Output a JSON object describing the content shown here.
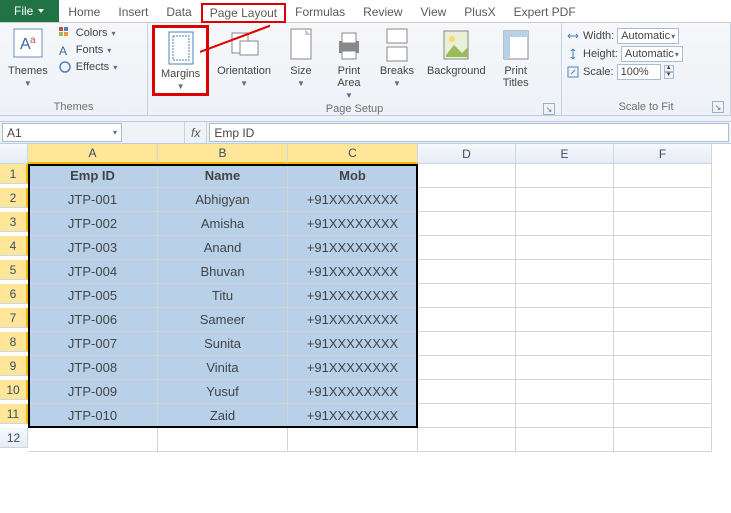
{
  "tabs": {
    "file": "File",
    "home": "Home",
    "insert": "Insert",
    "data": "Data",
    "pagelayout": "Page Layout",
    "formulas": "Formulas",
    "review": "Review",
    "view": "View",
    "plusx": "PlusX",
    "expertpdf": "Expert PDF"
  },
  "ribbon": {
    "themes": {
      "themes": "Themes",
      "colors": "Colors",
      "fonts": "Fonts",
      "effects": "Effects",
      "group": "Themes"
    },
    "pagesetup": {
      "margins": "Margins",
      "orientation": "Orientation",
      "size": "Size",
      "printarea": "Print\nArea",
      "breaks": "Breaks",
      "background": "Background",
      "printtitles": "Print\nTitles",
      "group": "Page Setup"
    },
    "scale": {
      "width": "Width:",
      "height": "Height:",
      "scale": "Scale:",
      "auto": "Automatic",
      "pct": "100%",
      "group": "Scale to Fit"
    }
  },
  "namebox": "A1",
  "fx": "fx",
  "formula_value": "Emp ID",
  "cols": [
    "A",
    "B",
    "C",
    "D",
    "E",
    "F"
  ],
  "rows": [
    "1",
    "2",
    "3",
    "4",
    "5",
    "6",
    "7",
    "8",
    "9",
    "10",
    "11",
    "12"
  ],
  "table": {
    "headers": [
      "Emp ID",
      "Name",
      "Mob"
    ],
    "data": [
      [
        "JTP-001",
        "Abhigyan",
        "+91XXXXXXXX"
      ],
      [
        "JTP-002",
        "Amisha",
        "+91XXXXXXXX"
      ],
      [
        "JTP-003",
        "Anand",
        "+91XXXXXXXX"
      ],
      [
        "JTP-004",
        "Bhuvan",
        "+91XXXXXXXX"
      ],
      [
        "JTP-005",
        "Titu",
        "+91XXXXXXXX"
      ],
      [
        "JTP-006",
        "Sameer",
        "+91XXXXXXXX"
      ],
      [
        "JTP-007",
        "Sunita",
        "+91XXXXXXXX"
      ],
      [
        "JTP-008",
        "Vinita",
        "+91XXXXXXXX"
      ],
      [
        "JTP-009",
        "Yusuf",
        "+91XXXXXXXX"
      ],
      [
        "JTP-010",
        "Zaid",
        "+91XXXXXXXX"
      ]
    ]
  }
}
